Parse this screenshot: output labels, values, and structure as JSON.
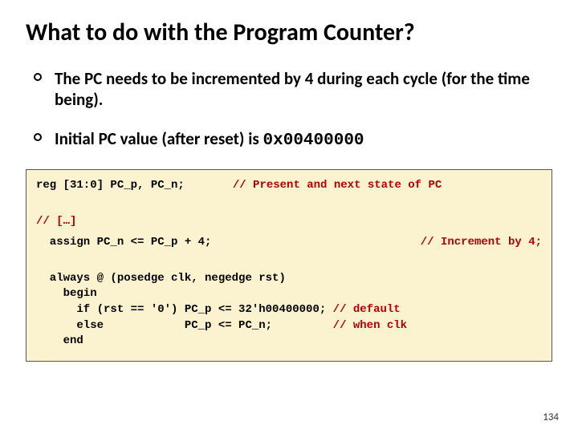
{
  "title": "What to do with the Program Counter?",
  "bullets": [
    "The PC needs to be incremented by 4 during each cycle (for the time being).",
    "Initial PC value (after reset) is "
  ],
  "hex_value": "0x00400000",
  "code": {
    "l1a": "reg [31:0] PC_p, PC_n;",
    "l1b": "// Present and next state of PC",
    "l2": "// […]",
    "l3a": "  assign PC_n <= PC_p + 4;",
    "l3b": "// Increment by 4;",
    "l4": "  always @ (posedge clk, negedge rst)",
    "l5": "    begin",
    "l6a": "      if (rst == '0') PC_p <= 32'h00400000; ",
    "l6b": "// default",
    "l7a": "      else            PC_p <= PC_n;         ",
    "l7b": "// when clk",
    "l8": "    end"
  },
  "slide_number": "134"
}
